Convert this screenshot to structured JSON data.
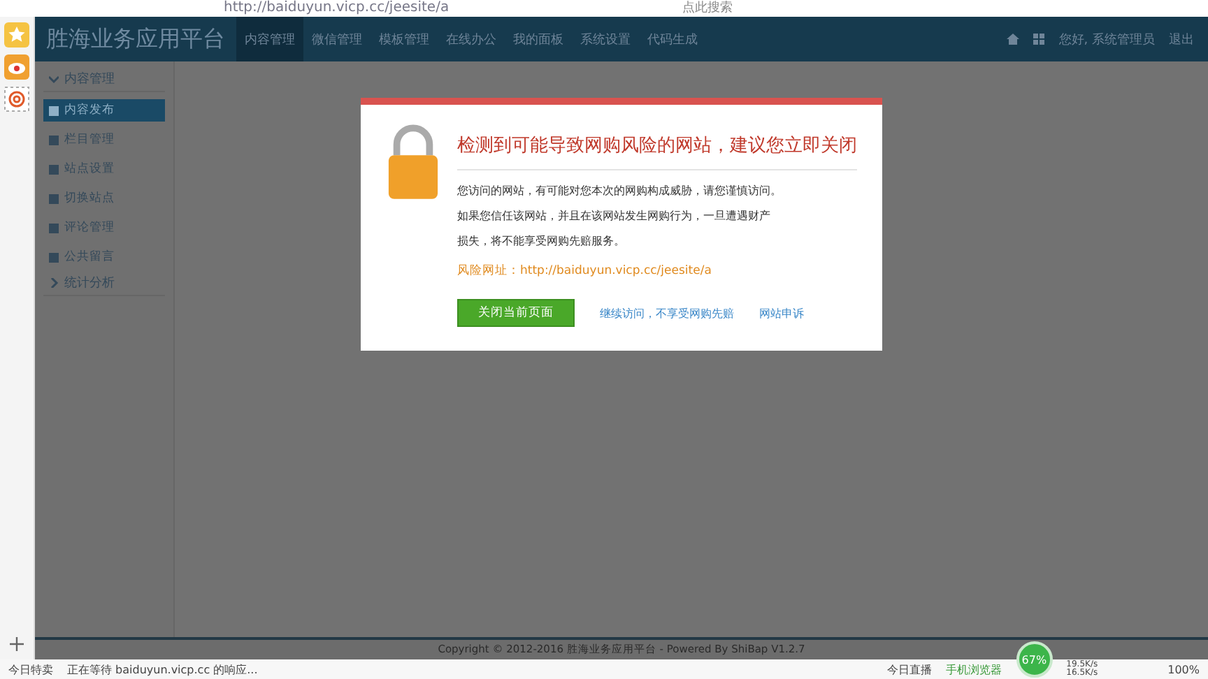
{
  "browser": {
    "url": "http://baiduyun.vicp.cc/jeesite/a",
    "search_placeholder": "点此搜索"
  },
  "app": {
    "title": "胜海业务应用平台",
    "nav": [
      {
        "label": "内容管理",
        "selected": true
      },
      {
        "label": "微信管理",
        "selected": false
      },
      {
        "label": "模板管理",
        "selected": false
      },
      {
        "label": "在线办公",
        "selected": false
      },
      {
        "label": "我的面板",
        "selected": false
      },
      {
        "label": "系统设置",
        "selected": false
      },
      {
        "label": "代码生成",
        "selected": false
      }
    ],
    "greeting": "您好, 系统管理员",
    "logout": "退出"
  },
  "sidebar": {
    "groups": [
      {
        "label": "内容管理",
        "expanded": true,
        "items": [
          {
            "label": "内容发布",
            "selected": true
          },
          {
            "label": "栏目管理",
            "selected": false
          },
          {
            "label": "站点设置",
            "selected": false
          },
          {
            "label": "切换站点",
            "selected": false
          },
          {
            "label": "评论管理",
            "selected": false
          },
          {
            "label": "公共留言",
            "selected": false
          }
        ]
      },
      {
        "label": "统计分析",
        "expanded": false
      }
    ]
  },
  "footer": "Copyright © 2012-2016 胜海业务应用平台 - Powered By ShiBap V1.2.7",
  "dialog": {
    "title": "检测到可能导致网购风险的网站，建议您立即关闭",
    "lines": [
      "您访问的网站，有可能对您本次的网购构成威胁，请您谨慎访问。",
      "如果您信任该网站，并且在该网站发生网购行为，一旦遭遇财产",
      "损失，将不能享受网购先赔服务。"
    ],
    "risk_url": "风险网址：http://baiduyun.vicp.cc/jeesite/a",
    "close_button": "关闭当前页面",
    "continue_link": "继续访问，不享受网购先赔",
    "report_link": "网站申诉"
  },
  "status_bar": {
    "sale": "今日特卖",
    "loading": "正在等待 baiduyun.vicp.cc 的响应...",
    "live": "今日直播",
    "mobile": "手机浏览器",
    "meter": "67%",
    "upload": "19.5K/s",
    "download": "16.5K/s",
    "zoom": "100%"
  }
}
